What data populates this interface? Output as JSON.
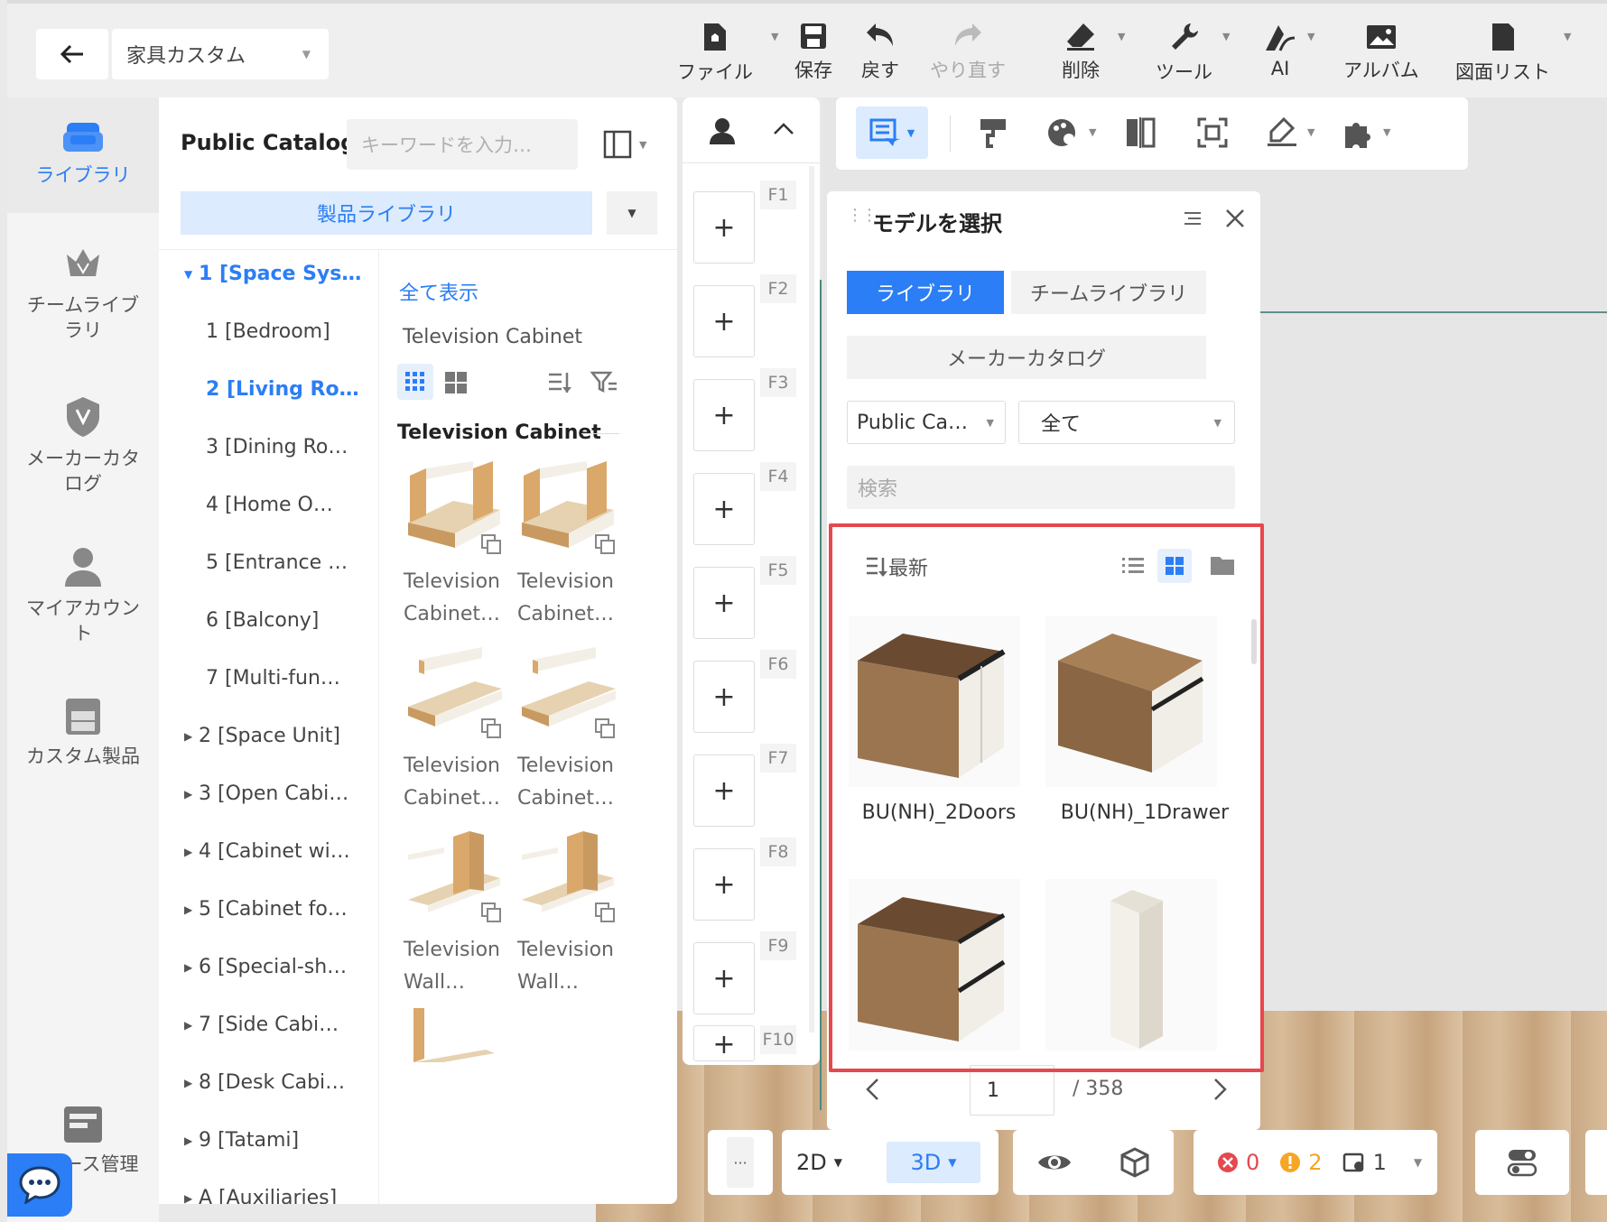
{
  "header": {
    "title": "家具カスタム",
    "toolbar": [
      {
        "label": "ファイル",
        "icon": "file-icon",
        "caret": true
      },
      {
        "label": "保存",
        "icon": "save-icon"
      },
      {
        "label": "戻す",
        "icon": "undo-icon"
      },
      {
        "label": "やり直す",
        "icon": "redo-icon",
        "disabled": true
      },
      {
        "label": "削除",
        "icon": "eraser-icon",
        "caret": true
      },
      {
        "label": "ツール",
        "icon": "wrench-icon",
        "caret": true
      },
      {
        "label": "AI",
        "icon": "ai-icon",
        "caret": true
      },
      {
        "label": "アルバム",
        "icon": "album-icon"
      },
      {
        "label": "図面リスト",
        "icon": "drawing-list-icon",
        "caret": true
      }
    ]
  },
  "sidebar": {
    "items": [
      {
        "label": "ライブラリ",
        "icon": "sofa-icon",
        "active": true
      },
      {
        "label": "チームライブラリ",
        "icon": "crown-icon"
      },
      {
        "label": "メーカーカタログ",
        "icon": "badge-icon"
      },
      {
        "label": "マイアカウント",
        "icon": "user-icon"
      },
      {
        "label": "カスタム製品",
        "icon": "cabinet-icon"
      },
      {
        "label": "ース管理",
        "icon": "resource-icon"
      }
    ]
  },
  "catalog": {
    "title": "Public Catalog",
    "search_placeholder": "キーワードを入力…",
    "library_button": "製品ライブラリ",
    "tree": [
      {
        "label": "1 [Space Sys…",
        "level": 0,
        "expanded": true,
        "selected": true
      },
      {
        "label": "1 [Bedroom]",
        "level": 1
      },
      {
        "label": "2 [Living Ro…",
        "level": 1,
        "selected": true
      },
      {
        "label": "3 [Dining Ro…",
        "level": 1
      },
      {
        "label": "4 [Home O…",
        "level": 1
      },
      {
        "label": "5 [Entrance …",
        "level": 1
      },
      {
        "label": "6 [Balcony]",
        "level": 1
      },
      {
        "label": "7 [Multi-fun…",
        "level": 1
      },
      {
        "label": "2 [Space Unit]",
        "level": 0
      },
      {
        "label": "3 [Open Cabi…",
        "level": 0
      },
      {
        "label": "4 [Cabinet wi…",
        "level": 0
      },
      {
        "label": "5 [Cabinet fo…",
        "level": 0
      },
      {
        "label": "6 [Special-sh…",
        "level": 0
      },
      {
        "label": "7 [Side Cabi…",
        "level": 0
      },
      {
        "label": "8 [Desk Cabi…",
        "level": 0
      },
      {
        "label": "9 [Tatami]",
        "level": 0
      },
      {
        "label": "A [Auxiliaries]",
        "level": 0
      }
    ],
    "show_all": "全て表示",
    "breadcrumb": "Television Cabinet",
    "section_title": "Television Cabinet",
    "products": [
      {
        "line1": "Television",
        "line2": "Cabinet…"
      },
      {
        "line1": "Television",
        "line2": "Cabinet…"
      },
      {
        "line1": "Television",
        "line2": "Cabinet…"
      },
      {
        "line1": "Television",
        "line2": "Cabinet…"
      },
      {
        "line1": "Television",
        "line2": "Wall…"
      },
      {
        "line1": "Television",
        "line2": "Wall…"
      }
    ]
  },
  "fkeys": [
    "F1",
    "F2",
    "F3",
    "F4",
    "F5",
    "F6",
    "F7",
    "F8",
    "F9",
    "F10"
  ],
  "model_panel": {
    "title": "モデルを選択",
    "tabs": [
      "ライブラリ",
      "チームライブラリ"
    ],
    "maker_catalog": "メーカーカタログ",
    "filter1": "Public Ca…",
    "filter2": "全て",
    "search_placeholder": "検索",
    "sort_label": "最新",
    "items": [
      {
        "name": "BU(NH)_2Doors"
      },
      {
        "name": "BU(NH)_1Drawer"
      },
      {
        "name": ""
      },
      {
        "name": ""
      }
    ],
    "page": "1",
    "total_pages": "/ 358"
  },
  "bottom": {
    "more": "···",
    "mode_2d": "2D",
    "mode_3d": "3D",
    "errors": "0",
    "warnings": "2",
    "info": "1"
  },
  "colors": {
    "accent": "#2b7ef5",
    "highlight": "#e5484d",
    "error": "#e5484d",
    "warning": "#f5a623"
  }
}
